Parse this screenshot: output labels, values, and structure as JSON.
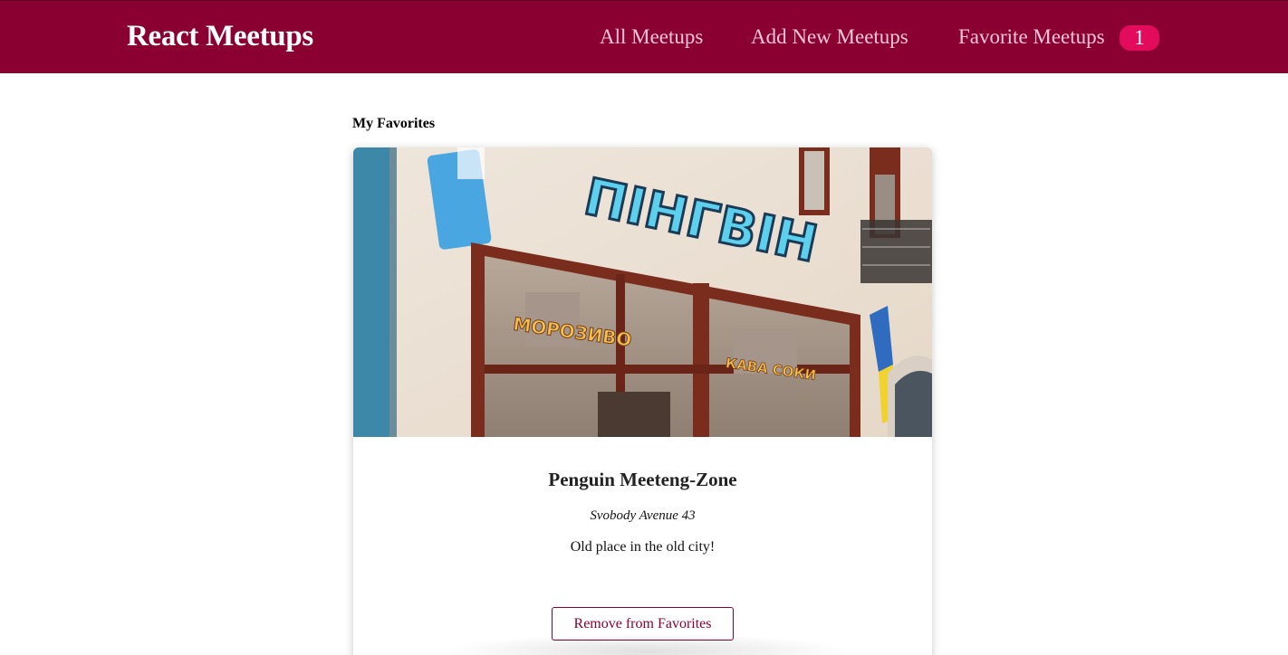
{
  "header": {
    "logo": "React Meetups",
    "nav": {
      "all": "All Meetups",
      "new": "Add New Meetups",
      "favorites": "Favorite Meetups",
      "favorites_count": "1"
    }
  },
  "page": {
    "section_title": "My Favorites"
  },
  "meetup": {
    "image_icon": "storefront-photo",
    "sign_main": "ПІНГВІН",
    "sign_left": "МОРОЗИВО",
    "sign_right": "КАВА СОКИ",
    "title": "Penguin Meeteng-Zone",
    "address": "Svobody Avenue 43",
    "description": "Old place in the old city!",
    "button_label": "Remove from Favorites"
  },
  "colors": {
    "header_bg": "#8a0030",
    "nav_text": "#f6c6d8",
    "badge_bg": "#e30b5c",
    "button_border": "#8a0030"
  }
}
